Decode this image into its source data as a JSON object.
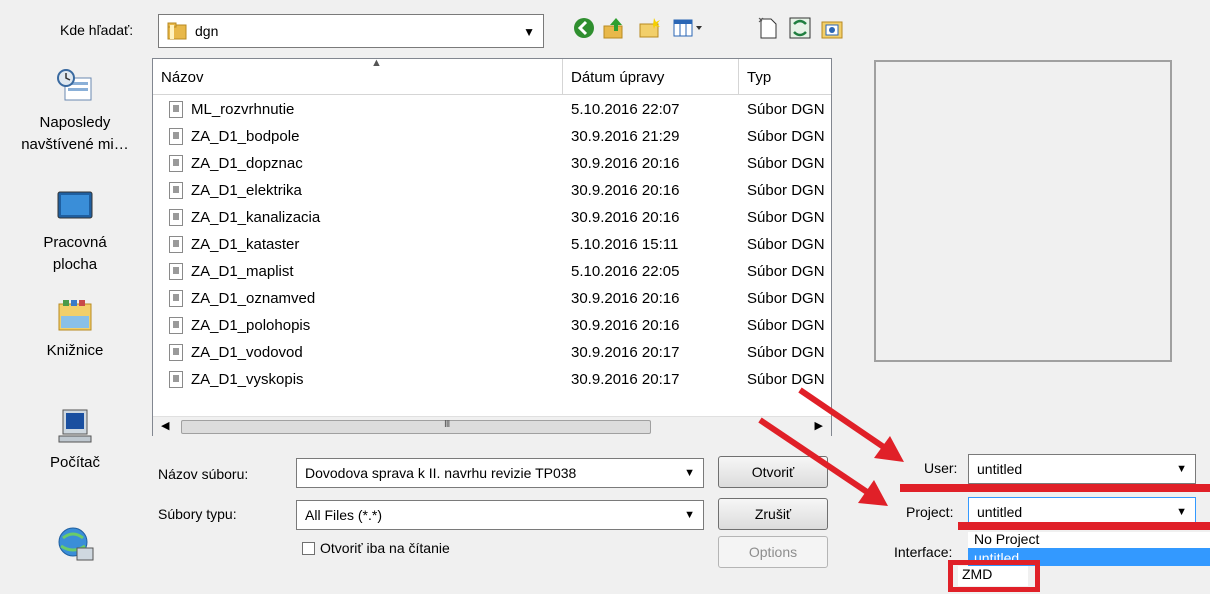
{
  "look_in": {
    "label": "Kde hľadať:",
    "value": "dgn"
  },
  "toolbar": {
    "icons": [
      "back-icon",
      "up-folder-icon",
      "new-folder-icon",
      "view-menu-icon",
      "new-file-icon",
      "refresh-icon",
      "star-folder-icon"
    ]
  },
  "places": [
    {
      "label": "Naposledy navštívené mi…",
      "icon": "recent-places-icon"
    },
    {
      "label": "Pracovná plocha",
      "icon": "desktop-icon"
    },
    {
      "label": "Knižnice",
      "icon": "libraries-icon"
    },
    {
      "label": "Počítač",
      "icon": "computer-icon"
    },
    {
      "label": "",
      "icon": "network-icon"
    }
  ],
  "columns": {
    "name": "Názov",
    "date": "Dátum úpravy",
    "type": "Typ"
  },
  "files": [
    {
      "name": "ML_rozvrhnutie",
      "date": "5.10.2016 22:07",
      "type": "Súbor DGN"
    },
    {
      "name": "ZA_D1_bodpole",
      "date": "30.9.2016 21:29",
      "type": "Súbor DGN"
    },
    {
      "name": "ZA_D1_dopznac",
      "date": "30.9.2016 20:16",
      "type": "Súbor DGN"
    },
    {
      "name": "ZA_D1_elektrika",
      "date": "30.9.2016 20:16",
      "type": "Súbor DGN"
    },
    {
      "name": "ZA_D1_kanalizacia",
      "date": "30.9.2016 20:16",
      "type": "Súbor DGN"
    },
    {
      "name": "ZA_D1_kataster",
      "date": "5.10.2016 15:11",
      "type": "Súbor DGN"
    },
    {
      "name": "ZA_D1_maplist",
      "date": "5.10.2016 22:05",
      "type": "Súbor DGN"
    },
    {
      "name": "ZA_D1_oznamved",
      "date": "30.9.2016 20:16",
      "type": "Súbor DGN"
    },
    {
      "name": "ZA_D1_polohopis",
      "date": "30.9.2016 20:16",
      "type": "Súbor DGN"
    },
    {
      "name": "ZA_D1_vodovod",
      "date": "30.9.2016 20:17",
      "type": "Súbor DGN"
    },
    {
      "name": "ZA_D1_vyskopis",
      "date": "30.9.2016 20:17",
      "type": "Súbor DGN"
    }
  ],
  "scroll_grip": "III",
  "filename": {
    "label": "Názov súboru:",
    "value": "Dovodova sprava k II. navrhu revizie TP038"
  },
  "filetype": {
    "label": "Súbory typu:",
    "value": "All Files (*.*)"
  },
  "readonly": {
    "label": "Otvoriť iba na čítanie",
    "checked": false
  },
  "buttons": {
    "open": "Otvoriť",
    "cancel": "Zrušiť",
    "options": "Options"
  },
  "user": {
    "label": "User:",
    "value": "untitled"
  },
  "project": {
    "label": "Project:",
    "value": "untitled"
  },
  "interface": {
    "label": "Interface:"
  },
  "project_dropdown": {
    "options": [
      "No Project",
      "untitled",
      "ZMD"
    ],
    "selected": "untitled"
  },
  "annotation_color": "#e02028"
}
